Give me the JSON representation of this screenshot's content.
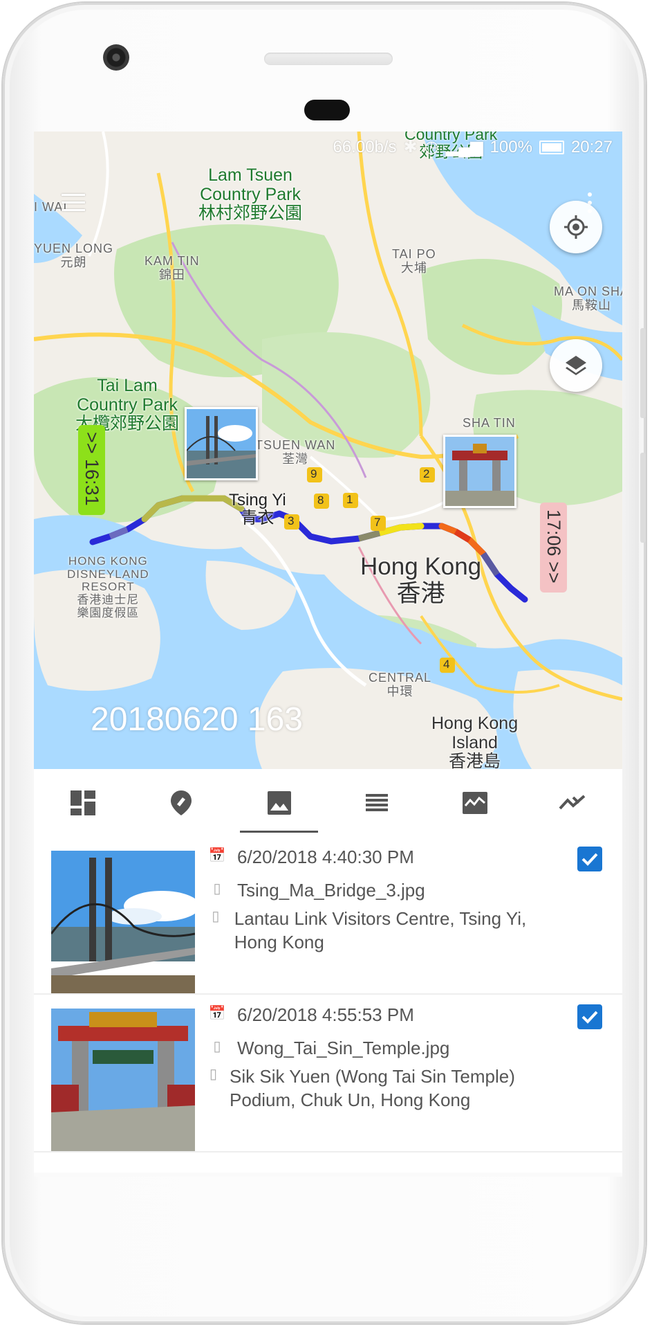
{
  "status_bar": {
    "speed": "66.00b/s",
    "battery": "100%",
    "time": "20:27"
  },
  "map": {
    "route_title": "20180620 163",
    "start_time_tag": ">> 16:31",
    "end_time_tag": "17:06 >>",
    "labels": {
      "lam_tsuen": "Lam Tsuen\nCountry Park\n林村郊野公園",
      "tai_lam": "Tai Lam\nCountry Park\n大欖郊野公園",
      "kam_tin": "KAM TIN\n錦田",
      "tai_po": "TAI PO\n大埔",
      "sha_tin": "SHA TIN",
      "tsuen_wan": "TSUEN WAN\n荃灣",
      "tsing_yi": "Tsing Yi\n青衣",
      "hong_kong": "Hong Kong\n香港",
      "disneyland": "HONG KONG\nDISNEYLAND\nRESORT\n香港迪士尼\n樂園度假區",
      "central": "CENTRAL\n中環",
      "hk_island": "Hong Kong\nIsland\n香港島",
      "yuen_long": "YUEN LONG\n元朗",
      "country_park_top": "Country Park\n郊野公園",
      "ma_on_shan": "MA ON SHA\n馬鞍山",
      "wai": "I WAI"
    },
    "markers": [
      "1",
      "2",
      "3",
      "4",
      "7",
      "8",
      "9"
    ]
  },
  "tabs": [
    {
      "icon": "dashboard-icon"
    },
    {
      "icon": "location-pin-icon"
    },
    {
      "icon": "image-icon",
      "active": true
    },
    {
      "icon": "list-icon"
    },
    {
      "icon": "chart-icon"
    },
    {
      "icon": "trend-icon"
    }
  ],
  "photos": [
    {
      "datetime": "6/20/2018 4:40:30 PM",
      "filename": "Tsing_Ma_Bridge_3.jpg",
      "location": "Lantau Link Visitors Centre, Tsing Yi, Hong Kong",
      "checked": true
    },
    {
      "datetime": "6/20/2018 4:55:53 PM",
      "filename": "Wong_Tai_Sin_Temple.jpg",
      "location": "Sik Sik Yuen (Wong Tai Sin Temple) Podium, Chuk Un, Hong Kong",
      "checked": true
    }
  ],
  "colors": {
    "accent": "#1976d2",
    "water": "#aadaff",
    "land": "#f2efe9",
    "park": "#c8e6b4",
    "road": "#ffd54f"
  }
}
